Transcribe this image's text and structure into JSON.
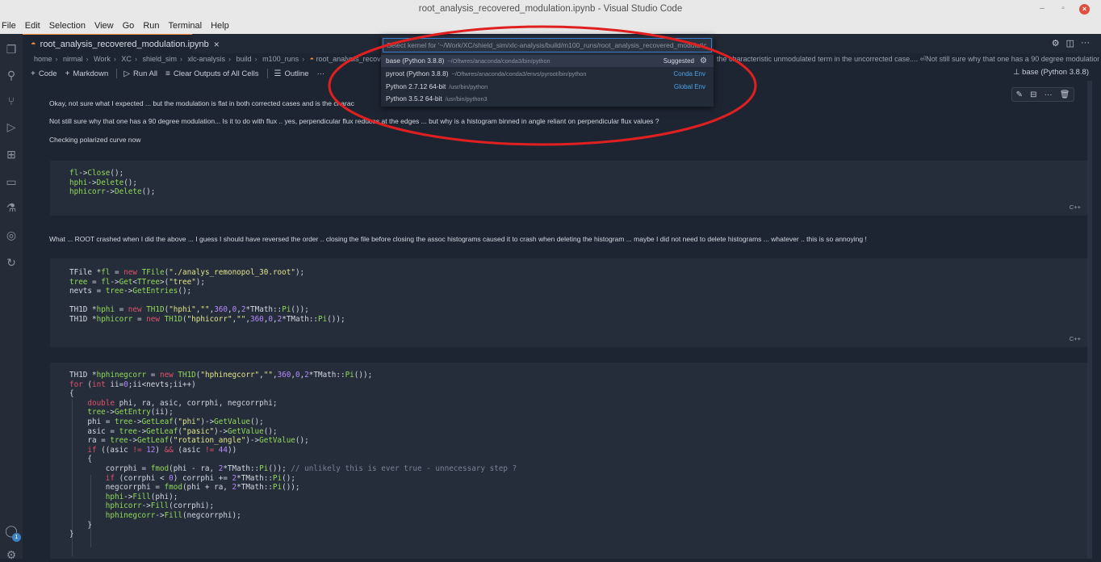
{
  "window": {
    "title": "root_analysis_recovered_modulation.ipynb - Visual Studio Code"
  },
  "menu": [
    "File",
    "Edit",
    "Selection",
    "View",
    "Go",
    "Run",
    "Terminal",
    "Help"
  ],
  "tab": {
    "label": "root_analysis_recovered_modulation.ipynb"
  },
  "breadcrumb": [
    "home",
    "nirmal",
    "Work",
    "XC",
    "shield_sim",
    "xlc-analysis",
    "build",
    "m100_runs",
    "root_analysis_recovered_m"
  ],
  "breadcrumb_tail": "the characteristic unmodulated term in the uncorrected case.... ⏎Not still sure why that one has a 90 degree modulation... Is it",
  "toolbar": {
    "code": "Code",
    "markdown": "Markdown",
    "run_all": "Run All",
    "clear_outputs": "Clear Outputs of All Cells",
    "outline": "Outline",
    "more": "···",
    "kernel": "base (Python 3.8.8)"
  },
  "kernel_picker": {
    "placeholder": "Select kernel for '~/Work/XC/shield_sim/xlc-analysis/build/m100_runs/root_analysis_recovered_modulatic",
    "items": [
      {
        "name": "base (Python 3.8.8)",
        "path": "~/Oftwres/anaconda/conda3/bin/python",
        "tag": "Suggested"
      },
      {
        "name": "pyroot (Python 3.8.8)",
        "path": "~/Oftwres/anaconda/conda3/envs/pyroot/bin/python",
        "tag": "Conda Env"
      },
      {
        "name": "Python 2.7.12 64-bit",
        "path": "/usr/bin/python",
        "tag": "Global Env"
      },
      {
        "name": "Python 3.5.2 64-bit",
        "path": "/usr/bin/python3",
        "tag": ""
      }
    ]
  },
  "markdown": {
    "line1": "Okay, not sure what I expected ... but the modulation is flat in both corrected cases and is the charac",
    "line2": "Not still sure why that one has a 90 degree modulation... Is it to do with flux .. yes, perpendicular flux reduces at the edges ... but why is a histogram binned in angle reliant on perpendicular flux values ?",
    "line3": "Checking polarized curve now",
    "line4": "What ... ROOT crashed when I did the above ... I guess I should have reversed the order .. closing the file before closing the assoc histograms caused it to crash when deleting the histogram ... maybe I did not need to delete histograms ... whatever .. this is so annoying !"
  },
  "cell_lang": "C++",
  "colors": {
    "keyword": "#e0516b",
    "function": "#93d95a",
    "string": "#e2e58a",
    "number": "#b58aff",
    "accent": "#3a7fd0",
    "annotation_circle": "#e02020"
  }
}
